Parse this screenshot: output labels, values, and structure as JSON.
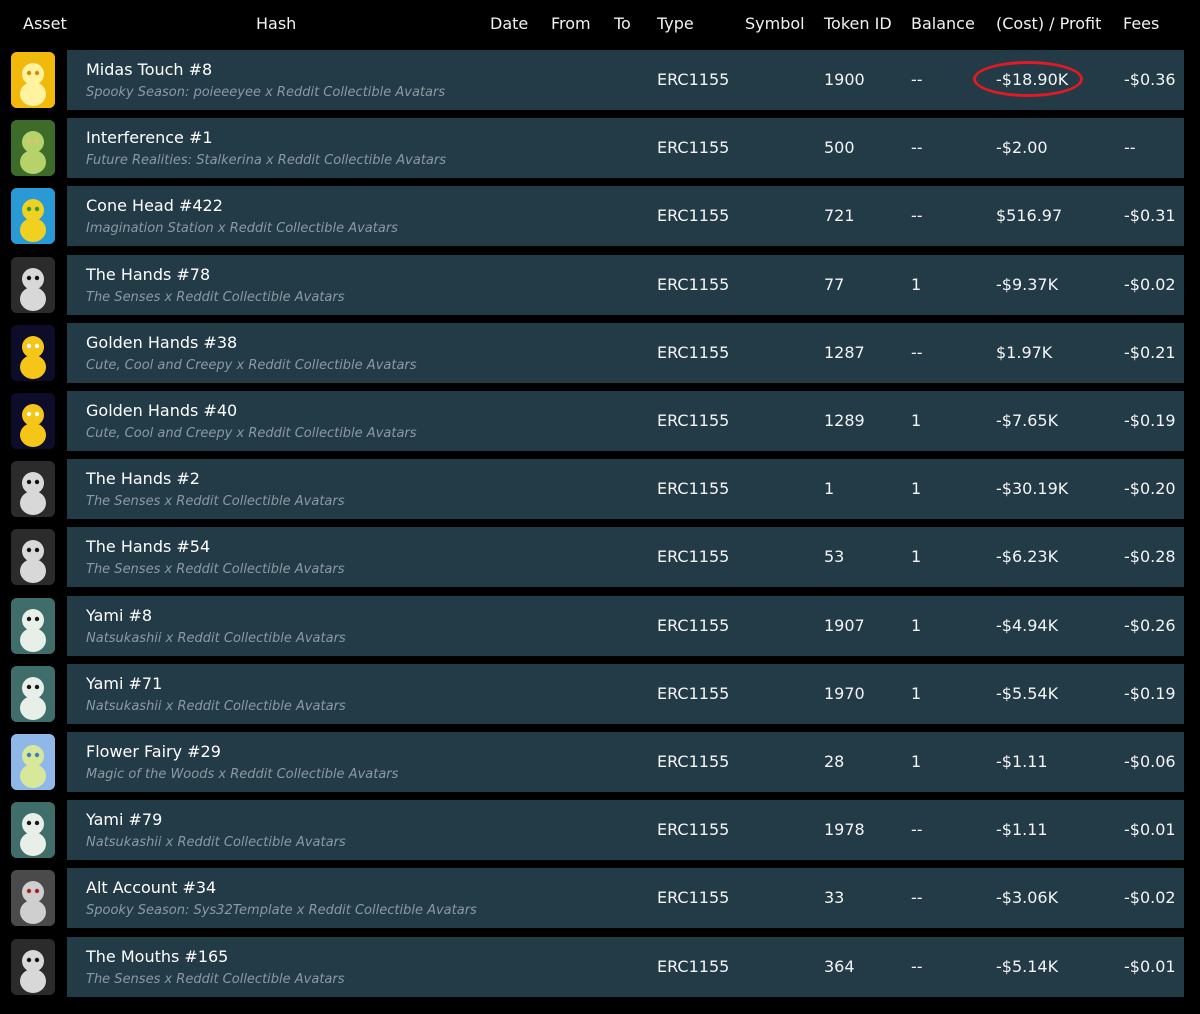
{
  "header": {
    "asset": "Asset",
    "hash": "Hash",
    "date": "Date",
    "from": "From",
    "to": "To",
    "type": "Type",
    "symbol": "Symbol",
    "token_id": "Token ID",
    "balance": "Balance",
    "cost_profit": "(Cost) / Profit",
    "fees": "Fees"
  },
  "colors": {
    "row_background": "#233a47",
    "page_background": "#000000",
    "highlight": "#e01b24"
  },
  "rows": [
    {
      "name": "Midas Touch #8",
      "collection": "Spooky Season: poieeeyee x Reddit Collectible Avatars",
      "type": "ERC1155",
      "token_id": "1900",
      "balance": "--",
      "profit": "-$18.90K",
      "fees": "-$0.36",
      "highlighted": true,
      "thumb": "yellow"
    },
    {
      "name": "Interference #1",
      "collection": "Future Realities: Stalkerina x Reddit Collectible Avatars",
      "type": "ERC1155",
      "token_id": "500",
      "balance": "--",
      "profit": "-$2.00",
      "fees": "--",
      "thumb": "green"
    },
    {
      "name": "Cone Head #422",
      "collection": "Imagination Station x Reddit Collectible Avatars",
      "type": "ERC1155",
      "token_id": "721",
      "balance": "--",
      "profit": "$516.97",
      "fees": "-$0.31",
      "thumb": "colorful"
    },
    {
      "name": "The Hands #78",
      "collection": "The Senses x Reddit Collectible Avatars",
      "type": "ERC1155",
      "token_id": "77",
      "balance": "1",
      "profit": "-$9.37K",
      "fees": "-$0.02",
      "thumb": "gray"
    },
    {
      "name": "Golden Hands #38",
      "collection": "Cute, Cool and Creepy x Reddit Collectible Avatars",
      "type": "ERC1155",
      "token_id": "1287",
      "balance": "--",
      "profit": "$1.97K",
      "fees": "-$0.21",
      "thumb": "gold"
    },
    {
      "name": "Golden Hands #40",
      "collection": "Cute, Cool and Creepy x Reddit Collectible Avatars",
      "type": "ERC1155",
      "token_id": "1289",
      "balance": "1",
      "profit": "-$7.65K",
      "fees": "-$0.19",
      "thumb": "gold"
    },
    {
      "name": "The Hands #2",
      "collection": "The Senses x Reddit Collectible Avatars",
      "type": "ERC1155",
      "token_id": "1",
      "balance": "1",
      "profit": "-$30.19K",
      "fees": "-$0.20",
      "thumb": "gray"
    },
    {
      "name": "The Hands #54",
      "collection": "The Senses x Reddit Collectible Avatars",
      "type": "ERC1155",
      "token_id": "53",
      "balance": "1",
      "profit": "-$6.23K",
      "fees": "-$0.28",
      "thumb": "gray"
    },
    {
      "name": "Yami #8",
      "collection": "Natsukashii x Reddit Collectible Avatars",
      "type": "ERC1155",
      "token_id": "1907",
      "balance": "1",
      "profit": "-$4.94K",
      "fees": "-$0.26",
      "thumb": "teal"
    },
    {
      "name": "Yami #71",
      "collection": "Natsukashii x Reddit Collectible Avatars",
      "type": "ERC1155",
      "token_id": "1970",
      "balance": "1",
      "profit": "-$5.54K",
      "fees": "-$0.19",
      "thumb": "teal"
    },
    {
      "name": "Flower Fairy #29",
      "collection": "Magic of the Woods x Reddit Collectible Avatars",
      "type": "ERC1155",
      "token_id": "28",
      "balance": "1",
      "profit": "-$1.11",
      "fees": "-$0.06",
      "thumb": "blue"
    },
    {
      "name": "Yami #79",
      "collection": "Natsukashii x Reddit Collectible Avatars",
      "type": "ERC1155",
      "token_id": "1978",
      "balance": "--",
      "profit": "-$1.11",
      "fees": "-$0.01",
      "thumb": "teal"
    },
    {
      "name": "Alt Account #34",
      "collection": "Spooky Season: Sys32Template x Reddit Collectible Avatars",
      "type": "ERC1155",
      "token_id": "33",
      "balance": "--",
      "profit": "-$3.06K",
      "fees": "-$0.02",
      "thumb": "darkgray"
    },
    {
      "name": "The Mouths #165",
      "collection": "The Senses x Reddit Collectible Avatars",
      "type": "ERC1155",
      "token_id": "364",
      "balance": "--",
      "profit": "-$5.14K",
      "fees": "-$0.01",
      "thumb": "gray"
    }
  ]
}
